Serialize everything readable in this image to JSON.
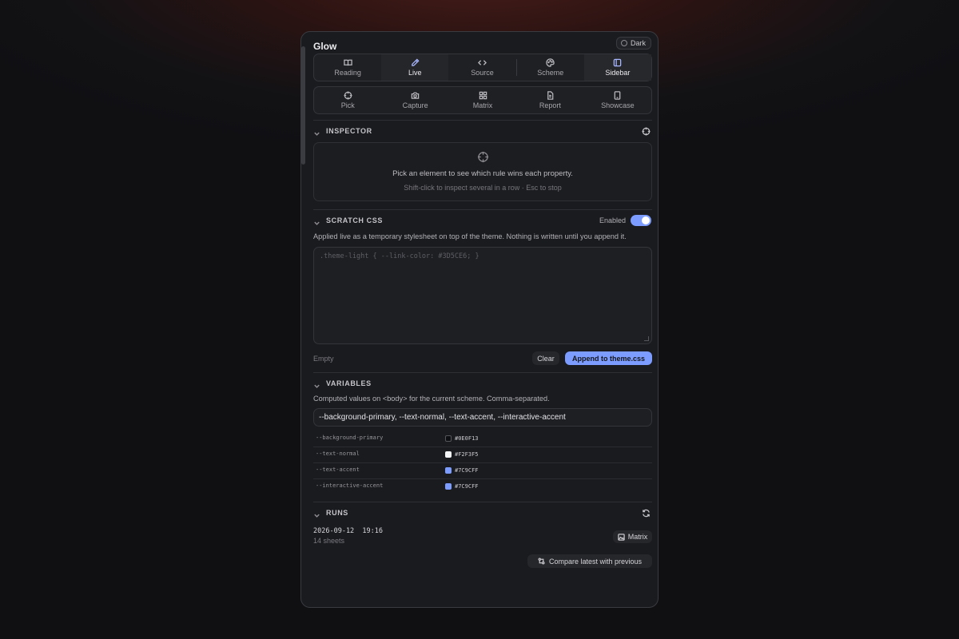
{
  "app": {
    "title": "Glow",
    "theme_label": "Dark"
  },
  "toolbar1": [
    {
      "label": "Reading",
      "icon": "book-icon"
    },
    {
      "label": "Live",
      "icon": "pencil-icon"
    },
    {
      "label": "Source",
      "icon": "code-icon"
    },
    {
      "label": "Scheme",
      "icon": "palette-icon"
    },
    {
      "label": "Sidebar",
      "icon": "sidebar-icon"
    }
  ],
  "toolbar2": [
    {
      "label": "Pick",
      "icon": "crosshair-icon"
    },
    {
      "label": "Capture",
      "icon": "camera-icon"
    },
    {
      "label": "Matrix",
      "icon": "grid-icon"
    },
    {
      "label": "Report",
      "icon": "document-icon"
    },
    {
      "label": "Showcase",
      "icon": "tablet-icon"
    }
  ],
  "inspector": {
    "title": "INSPECTOR",
    "message": "Pick an element to see which rule wins each property.",
    "hint": "Shift-click to inspect several in a row · Esc to stop"
  },
  "scratch": {
    "title": "SCRATCH CSS",
    "toggle_label": "Enabled",
    "enabled": true,
    "description": "Applied live as a temporary stylesheet on top of the theme. Nothing is written until you append it.",
    "placeholder": ".theme-light { --link-color: #3D5CE6; }",
    "status": "Empty",
    "clear_label": "Clear",
    "append_label": "Append to theme.css"
  },
  "variables": {
    "title": "VARIABLES",
    "description": "Computed values on <body> for the current scheme. Comma-separated.",
    "input_value": "--background-primary, --text-normal, --text-accent, --interactive-accent",
    "rows": [
      {
        "name": "--background-primary",
        "value": "#0E0F13",
        "color": "#0E0F13"
      },
      {
        "name": "--text-normal",
        "value": "#F2F3F5",
        "color": "#F2F3F5"
      },
      {
        "name": "--text-accent",
        "value": "#7C9CFF",
        "color": "#7C9CFF"
      },
      {
        "name": "--interactive-accent",
        "value": "#7C9CFF",
        "color": "#7C9CFF"
      }
    ]
  },
  "runs": {
    "title": "RUNS",
    "items": [
      {
        "date": "2026-09-12  19:16",
        "count": "14 sheets",
        "action_label": "Matrix"
      }
    ],
    "compare_label": "Compare latest with previous"
  },
  "colors": {
    "accent": "#7C9CFF",
    "panel": "#1A1B1F",
    "border": "#3A3B41"
  }
}
